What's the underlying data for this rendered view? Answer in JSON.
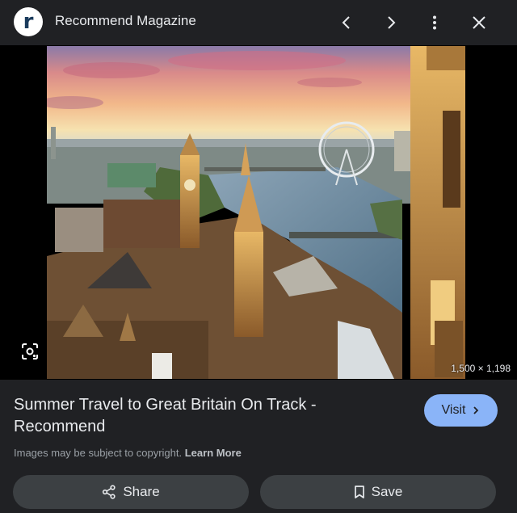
{
  "header": {
    "logo_letter": "r",
    "site_name": "Recommend Magazine",
    "icons": [
      "chevron-left-icon",
      "chevron-right-icon",
      "more-vert-icon",
      "close-icon"
    ]
  },
  "image": {
    "subject": "Aerial view of London: Houses of Parliament, Big Ben, River Thames and the London Eye at sunset",
    "dimensions": "1,500 × 1,198",
    "lens_icon": "google-lens-icon"
  },
  "result": {
    "title": "Summer Travel to Great Britain On Track - Recommend",
    "visit_label": "Visit",
    "copyright_text": "Images may be subject to copyright.",
    "learn_more": "Learn More"
  },
  "actions": {
    "share_label": "Share",
    "save_label": "Save"
  },
  "colors": {
    "background": "#202124",
    "accent": "#8ab4f8",
    "button": "#3c4043"
  }
}
